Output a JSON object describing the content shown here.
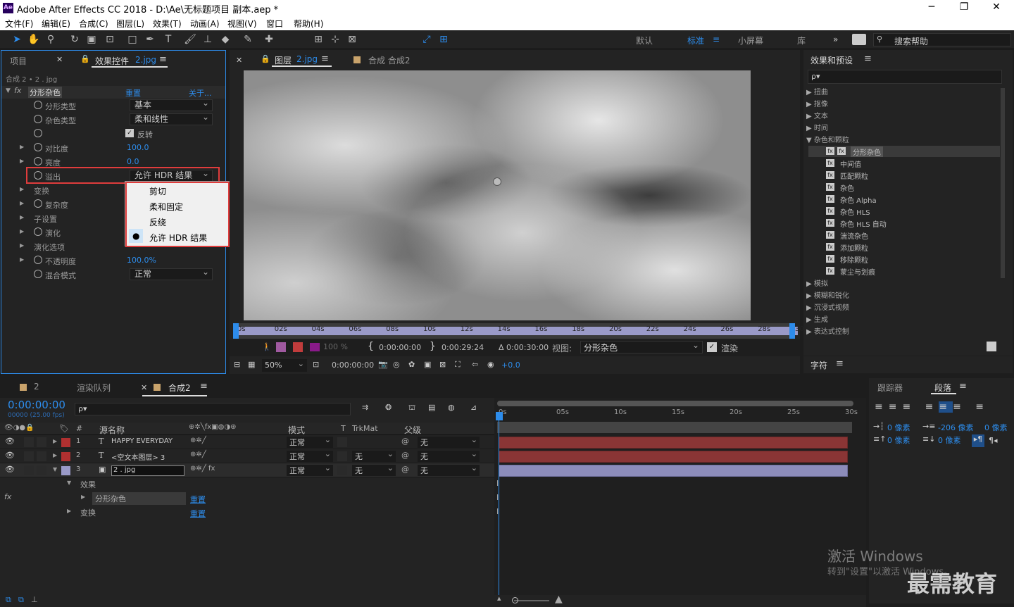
{
  "window": {
    "title": "Adobe After Effects CC 2018 - D:\\Ae\\无标题项目 副本.aep *",
    "app_icon": "Ae",
    "controls": [
      "─",
      "❐",
      "✕"
    ]
  },
  "menu": [
    "文件(F)",
    "编辑(E)",
    "合成(C)",
    "图层(L)",
    "效果(T)",
    "动画(A)",
    "视图(V)",
    "窗口",
    "帮助(H)"
  ],
  "toolbar": {
    "align_label": "对齐",
    "workspaces": [
      "默认",
      "标准",
      "小屏幕",
      "库"
    ],
    "active_workspace": "标准",
    "search_help": "搜索帮助"
  },
  "left_panel": {
    "tab_project": "项目",
    "tab_effects": "效果控件",
    "tab_effects_file": "2.jpg",
    "breadcrumb": "合成 2 • 2 . jpg",
    "effect_name": "分形杂色",
    "reset": "重置",
    "about": "关于...",
    "props": [
      {
        "label": "分形类型",
        "value": "基本",
        "kind": "dropdown"
      },
      {
        "label": "杂色类型",
        "value": "柔和线性",
        "kind": "dropdown"
      },
      {
        "label": "",
        "value": "反转",
        "kind": "checkbox"
      },
      {
        "label": "对比度",
        "value": "100.0",
        "kind": "number"
      },
      {
        "label": "亮度",
        "value": "0.0",
        "kind": "number"
      },
      {
        "label": "溢出",
        "value": "允许 HDR 结果",
        "kind": "dropdown"
      },
      {
        "label": "变换",
        "value": "",
        "kind": "group"
      },
      {
        "label": "复杂度",
        "value": "",
        "kind": "number"
      },
      {
        "label": "子设置",
        "value": "",
        "kind": "group"
      },
      {
        "label": "演化",
        "value": "",
        "kind": "number"
      },
      {
        "label": "演化选项",
        "value": "",
        "kind": "group"
      },
      {
        "label": "不透明度",
        "value": "100.0%",
        "kind": "number"
      },
      {
        "label": "混合模式",
        "value": "正常",
        "kind": "dropdown"
      }
    ]
  },
  "overflow_menu": {
    "items": [
      "剪切",
      "柔和固定",
      "反绕",
      "允许 HDR 结果"
    ],
    "selected": "允许 HDR 结果"
  },
  "viewer": {
    "tab_layer": "图层",
    "tab_layer_file": "2.jpg",
    "tab_comp": "合成 合成2",
    "ruler": [
      "0s",
      "02s",
      "04s",
      "06s",
      "08s",
      "10s",
      "12s",
      "14s",
      "16s",
      "18s",
      "20s",
      "22s",
      "24s",
      "26s",
      "28s",
      "30s"
    ],
    "opacity": "100 %",
    "in_time": "0:00:00:00",
    "out_time": "0:00:29:24",
    "duration": "Δ 0:00:30:00",
    "view_label": "视图:",
    "view_value": "分形杂色",
    "render_label": "渲染",
    "zoom": "50%",
    "current_time": "0:00:00:00",
    "exposure": "+0.0"
  },
  "right_panel": {
    "tab": "效果和预设",
    "search_placeholder": "ρ▾",
    "tree": [
      {
        "label": "扭曲",
        "open": false
      },
      {
        "label": "抠像",
        "open": false
      },
      {
        "label": "文本",
        "open": false
      },
      {
        "label": "时间",
        "open": false
      },
      {
        "label": "杂色和颗粒",
        "open": true
      }
    ],
    "children": [
      "分形杂色",
      "中间值",
      "匹配颗粒",
      "杂色",
      "杂色 Alpha",
      "杂色 HLS",
      "杂色 HLS 自动",
      "湍流杂色",
      "添加颗粒",
      "移除颗粒",
      "蒙尘与划痕"
    ],
    "selected_child": "分形杂色",
    "tree_after": [
      "模拟",
      "模糊和锐化",
      "沉浸式视频",
      "生成",
      "表达式控制"
    ],
    "tab_char": "字符",
    "tab_tracker": "跟踪器",
    "tab_paragraph": "段落",
    "para_values": {
      "indent_left": "0 像素",
      "indent_first": "-206 像素",
      "indent_right": "0 像素",
      "space_before": "0 像素",
      "space_after": "0 像素"
    }
  },
  "timeline": {
    "tab_2": "2",
    "tab_render": "渲染队列",
    "tab_comp": "合成2",
    "timecode": "0:00:00:00",
    "fps": "00000 (25.00 fps)",
    "headers": {
      "num": "#",
      "source": "源名称",
      "mode": "模式",
      "t": "T",
      "trkmat": "TrkMat",
      "parent": "父级"
    },
    "layers": [
      {
        "num": "1",
        "type": "T",
        "name": "HAPPY EVERYDAY",
        "mode": "正常",
        "trkmat": "",
        "parent": "无",
        "color": "#b03030"
      },
      {
        "num": "2",
        "type": "T",
        "name": "<空文本图层> 3",
        "mode": "正常",
        "trkmat": "无",
        "parent": "无",
        "color": "#b03030"
      },
      {
        "num": "3",
        "type": "img",
        "name": "2 . jpg",
        "mode": "正常",
        "trkmat": "无",
        "parent": "无",
        "color": "#9a9ac8"
      }
    ],
    "sub_effects": "效果",
    "sub_fx": "分形杂色",
    "sub_fx_reset": "重置",
    "sub_transform": "变换",
    "sub_transform_reset": "重置",
    "ruler": [
      "0s",
      "05s",
      "10s",
      "15s",
      "20s",
      "25s",
      "30s"
    ]
  },
  "watermark": {
    "line1": "激活 Windows",
    "line2": "转到\"设置\"以激活 Windows。",
    "brand": "最需教育"
  }
}
